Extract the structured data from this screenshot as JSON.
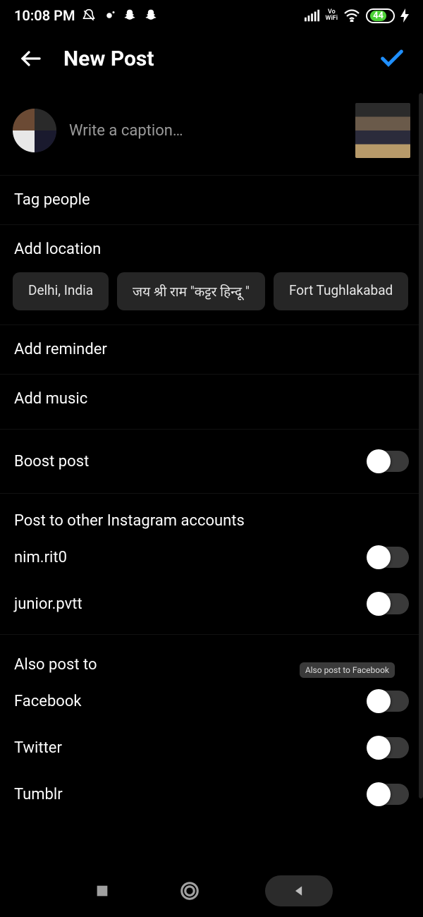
{
  "status": {
    "time": "10:08 PM",
    "battery": "44",
    "vo_wifi": "Vo\nWiFi"
  },
  "header": {
    "title": "New Post"
  },
  "caption": {
    "placeholder": "Write a caption…"
  },
  "rows": {
    "tag_people": "Tag people",
    "add_location": "Add location",
    "add_reminder": "Add reminder",
    "add_music": "Add music",
    "boost_post": "Boost post"
  },
  "location_suggestions": [
    "Delhi, India",
    "जय श्री राम \"कट्टर हिन्दू \"",
    "Fort Tughlakabad"
  ],
  "other_accounts": {
    "title": "Post to other Instagram accounts",
    "items": [
      "nim.rit0",
      "junior.pvtt"
    ]
  },
  "also_post": {
    "title": "Also post to",
    "tooltip": "Also post to Facebook",
    "items": [
      "Facebook",
      "Twitter",
      "Tumblr"
    ]
  }
}
